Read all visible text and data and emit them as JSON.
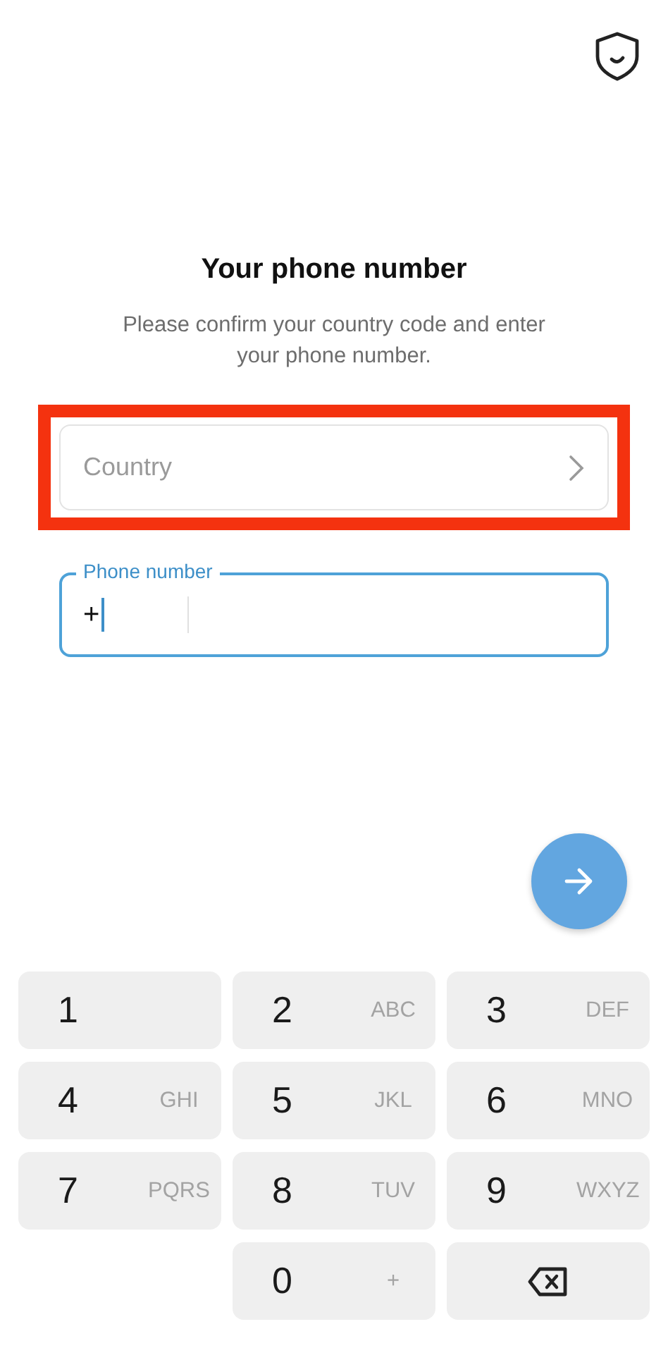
{
  "title": "Your phone number",
  "subtitle": "Please confirm your country code and enter your phone number.",
  "country": {
    "placeholder": "Country",
    "highlighted": true
  },
  "phone": {
    "label": "Phone number",
    "code": "+",
    "focused": true
  },
  "keypad": [
    {
      "kind": "digit",
      "digit": "1"
    },
    {
      "kind": "digit",
      "digit": "2",
      "letters": "ABC"
    },
    {
      "kind": "digit",
      "digit": "3",
      "letters": "DEF"
    },
    {
      "kind": "digit",
      "digit": "4",
      "letters": "GHI"
    },
    {
      "kind": "digit",
      "digit": "5",
      "letters": "JKL"
    },
    {
      "kind": "digit",
      "digit": "6",
      "letters": "MNO"
    },
    {
      "kind": "digit",
      "digit": "7",
      "letters": "PQRS"
    },
    {
      "kind": "digit",
      "digit": "8",
      "letters": "TUV"
    },
    {
      "kind": "digit",
      "digit": "9",
      "letters": "WXYZ"
    },
    {
      "kind": "blank"
    },
    {
      "kind": "digit",
      "digit": "0",
      "letters": "+"
    },
    {
      "kind": "backspace"
    }
  ]
}
